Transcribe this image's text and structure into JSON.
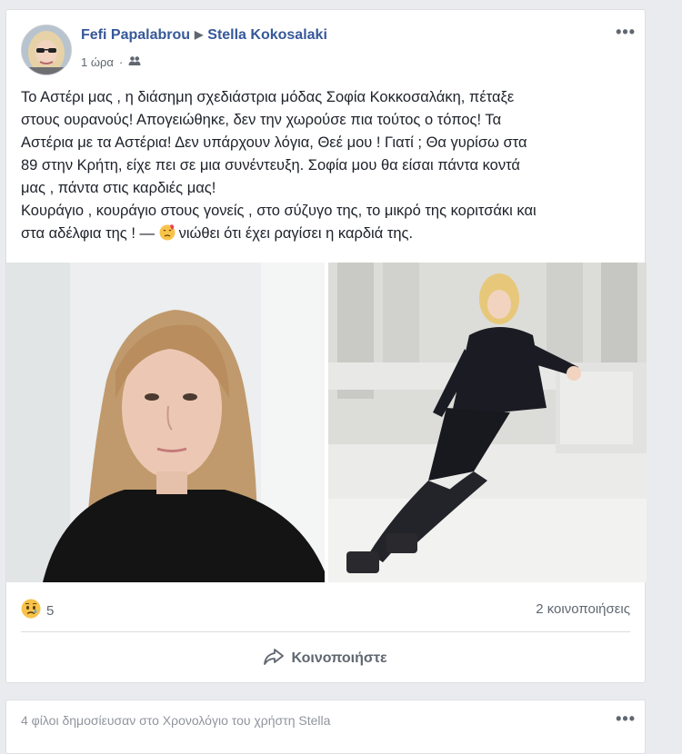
{
  "post": {
    "author": "Fefi Papalabrou",
    "recipient": "Stella Kokosalaki",
    "time": "1 ώρα",
    "more_label": "•••",
    "text_lines": [
      "Το Αστέρι μας , η διάσημη σχεδιάστρια μόδας Σοφία Κοκκοσαλάκη, πέταξε",
      "στους ουρανούς! Απογειώθηκε, δεν την χωρούσε πια τούτος ο τόπος! Τα",
      "Αστέρια με τα Αστέρια! Δεν υπάρχουν λόγια, Θεέ μου ! Γιατί ; Θα γυρίσω στα",
      "89 στην Κρήτη, είχε πει σε μια συνέντευξη. Σοφία μου θα είσαι πάντα κοντά",
      "μας , πάντα στις καρδιές μας!",
      "Κουράγιο , κουράγιο στους γονείς , στο σύζυγο της, το μικρό της κοριτσάκι και"
    ],
    "last_line_prefix": "στα αδέλφια της ! — ",
    "feeling_text": "νιώθει ότι έχει ραγίσει η καρδιά της.",
    "reaction_count": "5",
    "shares": "2 κοινοποιήσεις",
    "share_button": "Κοινοποιήστε"
  },
  "next_post": {
    "text": "4 φίλοι δημοσίευσαν στο Χρονολόγιο του χρήστη Stella",
    "more_label": "•••"
  },
  "icons": {
    "audience": "friends-icon",
    "reaction": "sad-face-icon",
    "feeling": "broken-heart-face-icon",
    "share": "share-arrow-icon"
  },
  "colors": {
    "link": "#365899",
    "meta": "#616770",
    "background": "#e9ebee"
  }
}
